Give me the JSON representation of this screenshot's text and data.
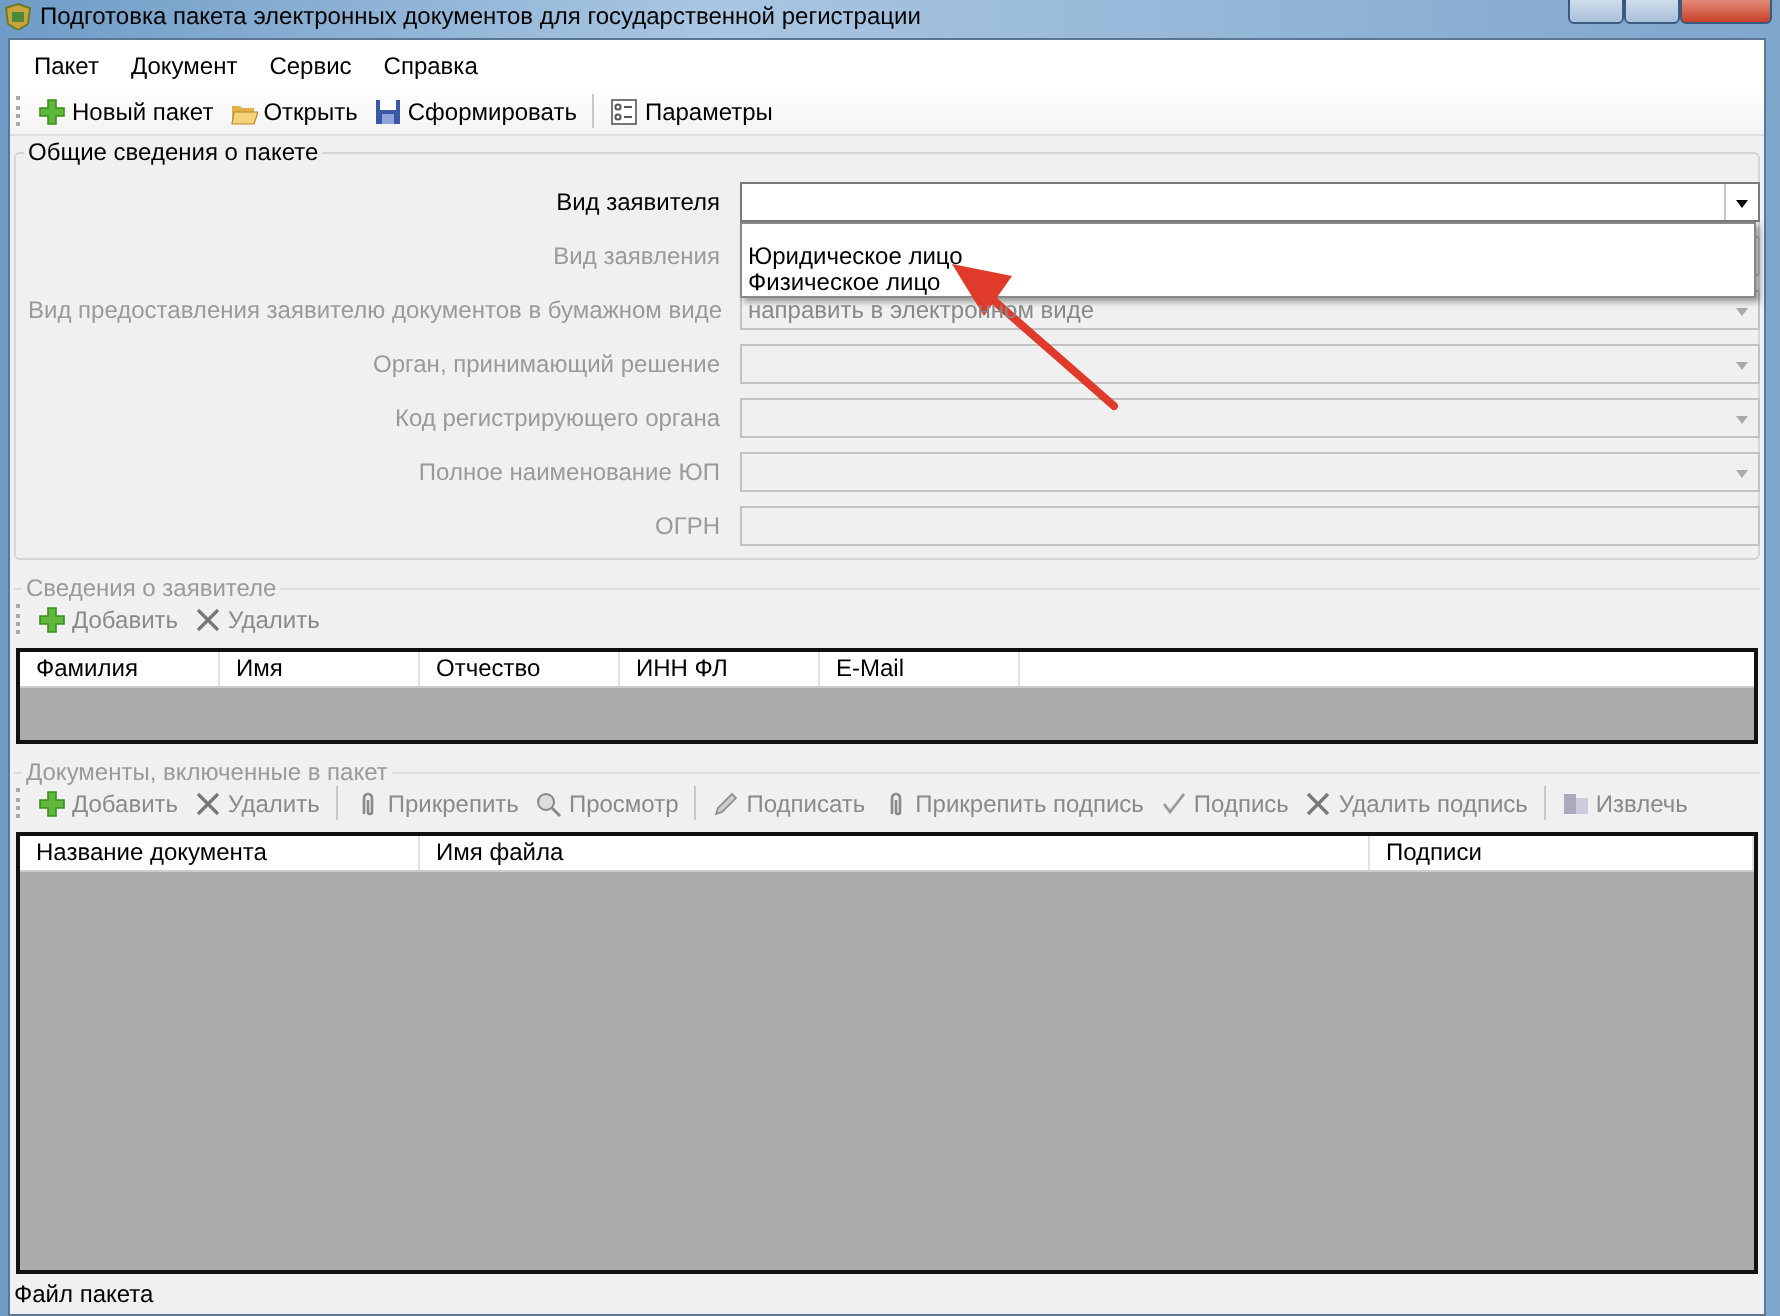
{
  "window": {
    "title": "Подготовка пакета электронных документов для государственной регистрации"
  },
  "menu": [
    "Пакет",
    "Документ",
    "Сервис",
    "Справка"
  ],
  "toolbar": [
    {
      "label": "Новый пакет",
      "disabled": false
    },
    {
      "label": "Открыть",
      "disabled": false
    },
    {
      "label": "Сформировать",
      "disabled": false
    },
    {
      "kind": "separator"
    },
    {
      "label": "Параметры",
      "disabled": false
    }
  ],
  "package_group": {
    "title": "Общие сведения о пакете",
    "fields": [
      {
        "label": "Вид заявителя",
        "kind": "combo",
        "disabled": false,
        "open": true,
        "options": [
          "Юридическое лицо",
          "Физическое лицо"
        ]
      },
      {
        "label": "Вид заявления",
        "kind": "combo",
        "disabled": true
      },
      {
        "label": "Вид предоставления заявителю документов в бумажном виде",
        "kind": "combo",
        "disabled": true,
        "value": "направить в электронном виде"
      },
      {
        "label": "Орган, принимающий решение",
        "kind": "combo",
        "disabled": true
      },
      {
        "label": "Код регистрирующего органа",
        "kind": "combo",
        "disabled": true
      },
      {
        "label": "Полное наименование ЮП",
        "kind": "combo",
        "disabled": true
      },
      {
        "label": "ОГРН",
        "kind": "text",
        "disabled": true
      }
    ]
  },
  "applicant_group": {
    "title": "Сведения о заявителе",
    "toolbar": [
      {
        "label": "Добавить",
        "disabled": true
      },
      {
        "label": "Удалить",
        "disabled": true
      }
    ],
    "columns": [
      "Фамилия",
      "Имя",
      "Отчество",
      "ИНН ФЛ",
      "E-Mail"
    ]
  },
  "documents_group": {
    "title": "Документы, включенные в пакет",
    "toolbar": [
      {
        "label": "Добавить",
        "disabled": true
      },
      {
        "label": "Удалить",
        "disabled": true
      },
      {
        "kind": "separator"
      },
      {
        "label": "Прикрепить",
        "disabled": true
      },
      {
        "label": "Просмотр",
        "disabled": true
      },
      {
        "kind": "separator"
      },
      {
        "label": "Подписать",
        "disabled": true
      },
      {
        "label": "Прикрепить подпись",
        "disabled": true
      },
      {
        "label": "Подпись",
        "disabled": true
      },
      {
        "label": "Удалить подпись",
        "disabled": true
      },
      {
        "kind": "separator"
      },
      {
        "label": "Извлечь",
        "disabled": true
      }
    ],
    "columns": [
      "Название документа",
      "Имя файла",
      "Подписи"
    ]
  },
  "status_bar": "Файл пакета"
}
